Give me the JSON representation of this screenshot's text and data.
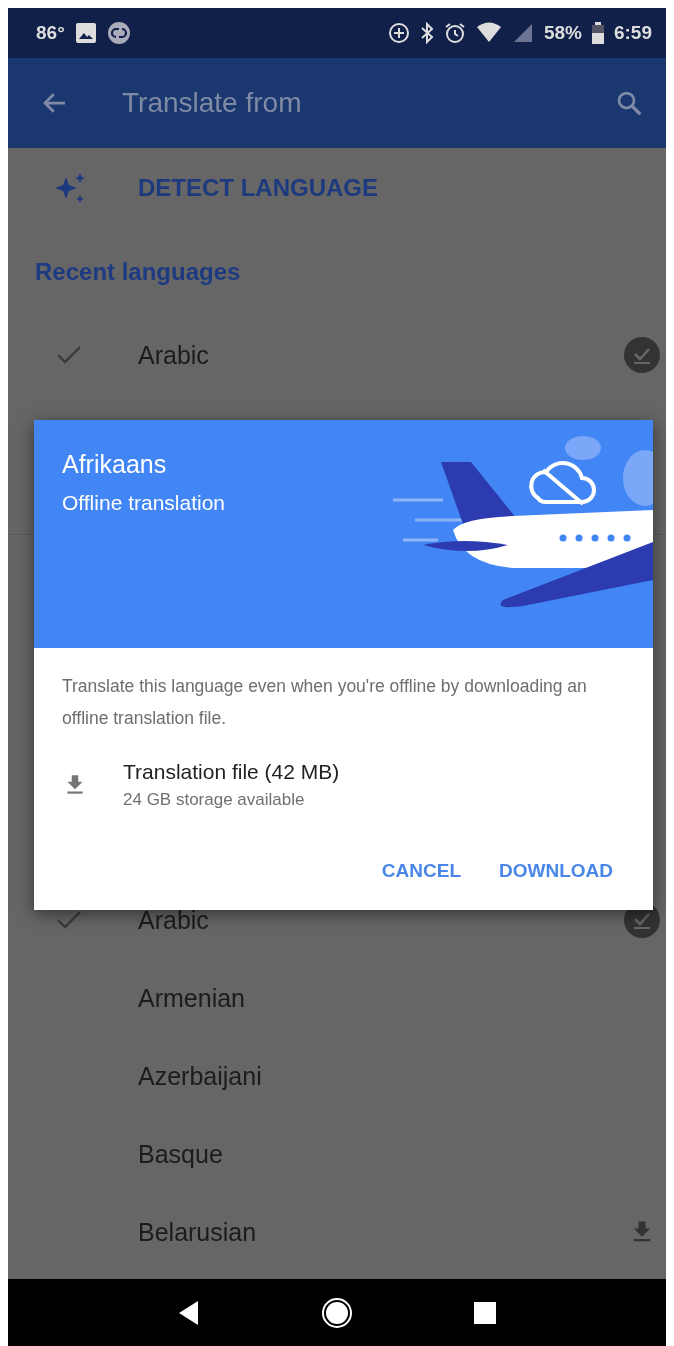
{
  "status_bar": {
    "temperature": "86°",
    "battery": "58%",
    "time": "6:59"
  },
  "app_bar": {
    "title": "Translate from"
  },
  "detect_language": {
    "label": "DETECT LANGUAGE"
  },
  "recent_languages": {
    "header": "Recent languages",
    "items": [
      {
        "name": "Arabic",
        "selected": true,
        "downloaded": true,
        "download_available": false
      }
    ]
  },
  "all_languages": {
    "items": [
      {
        "name": "Arabic",
        "selected": true,
        "downloaded": true,
        "download_available": false
      },
      {
        "name": "Armenian",
        "selected": false,
        "downloaded": false,
        "download_available": false
      },
      {
        "name": "Azerbaijani",
        "selected": false,
        "downloaded": false,
        "download_available": false
      },
      {
        "name": "Basque",
        "selected": false,
        "downloaded": false,
        "download_available": false
      },
      {
        "name": "Belarusian",
        "selected": false,
        "downloaded": false,
        "download_available": true
      }
    ]
  },
  "dialog": {
    "title": "Afrikaans",
    "subtitle": "Offline translation",
    "message": "Translate this language even when you're offline by downloading an offline translation file.",
    "file": {
      "name": "Translation file (42 MB)",
      "detail": "24 GB storage available"
    },
    "buttons": [
      "CANCEL",
      "DOWNLOAD"
    ]
  }
}
